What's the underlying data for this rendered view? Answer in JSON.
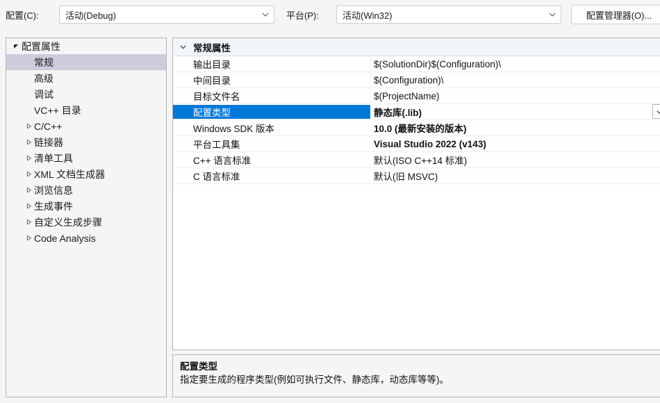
{
  "toolbar": {
    "config_label": "配置(C):",
    "config_value": "活动(Debug)",
    "platform_label": "平台(P):",
    "platform_value": "活动(Win32)",
    "config_manager_button": "配置管理器(O)..."
  },
  "sidebar": {
    "items": [
      {
        "label": "配置属性",
        "indent": 0,
        "arrow": "expanded",
        "selected": false
      },
      {
        "label": "常规",
        "indent": 1,
        "arrow": "none",
        "selected": true
      },
      {
        "label": "高级",
        "indent": 1,
        "arrow": "none",
        "selected": false
      },
      {
        "label": "调试",
        "indent": 1,
        "arrow": "none",
        "selected": false
      },
      {
        "label": "VC++ 目录",
        "indent": 1,
        "arrow": "none",
        "selected": false
      },
      {
        "label": "C/C++",
        "indent": 1,
        "arrow": "collapsed",
        "selected": false
      },
      {
        "label": "链接器",
        "indent": 1,
        "arrow": "collapsed",
        "selected": false
      },
      {
        "label": "清单工具",
        "indent": 1,
        "arrow": "collapsed",
        "selected": false
      },
      {
        "label": "XML 文档生成器",
        "indent": 1,
        "arrow": "collapsed",
        "selected": false
      },
      {
        "label": "浏览信息",
        "indent": 1,
        "arrow": "collapsed",
        "selected": false
      },
      {
        "label": "生成事件",
        "indent": 1,
        "arrow": "collapsed",
        "selected": false
      },
      {
        "label": "自定义生成步骤",
        "indent": 1,
        "arrow": "collapsed",
        "selected": false
      },
      {
        "label": "Code Analysis",
        "indent": 1,
        "arrow": "collapsed",
        "selected": false
      }
    ]
  },
  "grid": {
    "section_title": "常规属性",
    "rows": [
      {
        "name": "输出目录",
        "value": "$(SolutionDir)$(Configuration)\\",
        "bold": false,
        "selected": false
      },
      {
        "name": "中间目录",
        "value": "$(Configuration)\\",
        "bold": false,
        "selected": false
      },
      {
        "name": "目标文件名",
        "value": "$(ProjectName)",
        "bold": false,
        "selected": false
      },
      {
        "name": "配置类型",
        "value": "静态库(.lib)",
        "bold": true,
        "selected": true
      },
      {
        "name": "Windows SDK 版本",
        "value": "10.0 (最新安装的版本)",
        "bold": true,
        "selected": false
      },
      {
        "name": "平台工具集",
        "value": "Visual Studio 2022 (v143)",
        "bold": true,
        "selected": false
      },
      {
        "name": "C++ 语言标准",
        "value": "默认(ISO C++14 标准)",
        "bold": false,
        "selected": false
      },
      {
        "name": "C 语言标准",
        "value": "默认(旧 MSVC)",
        "bold": false,
        "selected": false
      }
    ]
  },
  "description": {
    "title": "配置类型",
    "text": "指定要生成的程序类型(例如可执行文件、静态库，动态库等等)。"
  },
  "colors": {
    "selection_blue": "#0078D7",
    "tree_selection": "#CCCCDC",
    "window_bg": "#F5F5F5",
    "grid_bg": "#FFFFFF"
  }
}
